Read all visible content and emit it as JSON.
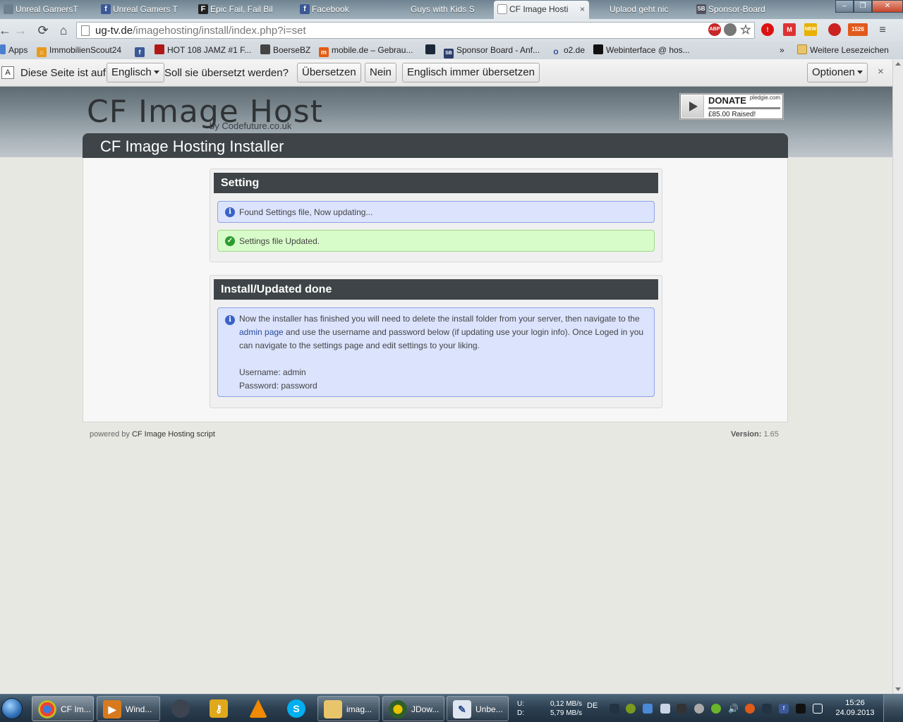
{
  "browser": {
    "tabs": [
      {
        "label": "Unreal GamersT",
        "icon": "generic-favicon",
        "active": false
      },
      {
        "label": "Unreal Gamers T",
        "icon": "facebook-favicon",
        "active": false
      },
      {
        "label": "Epic Fail, Fail Bil",
        "icon": "f-favicon",
        "active": false
      },
      {
        "label": "Facebook",
        "icon": "facebook-favicon",
        "active": false
      },
      {
        "label": "Guys with Kids S",
        "icon": "generic-favicon",
        "active": false
      },
      {
        "label": "CF Image Hosti",
        "icon": "page-favicon",
        "active": true
      },
      {
        "label": "Uplaod geht nic",
        "icon": "generic-favicon",
        "active": false
      },
      {
        "label": "Sponsor-Board",
        "icon": "sb-favicon",
        "active": false
      }
    ],
    "tab_close_glyph": "×",
    "window_controls": [
      "–",
      "❐",
      "✕"
    ],
    "url": {
      "host": "ug-tv.de",
      "path": "/imagehosting/install/index.php?i=set"
    },
    "extension_badges": {
      "abp": "ABP",
      "new": "NEW",
      "count": "1526"
    },
    "bookmarks": [
      {
        "label": "Apps",
        "icon": "apps-icon"
      },
      {
        "label": "ImmobilienScout24",
        "icon": "house-icon"
      },
      {
        "label": "",
        "icon": "facebook-icon"
      },
      {
        "label": "HOT 108 JAMZ #1 F...",
        "icon": "radio-icon"
      },
      {
        "label": "BoerseBZ",
        "icon": "boerse-icon"
      },
      {
        "label": "mobile.de – Gebrau...",
        "icon": "mobile-de-icon"
      },
      {
        "label": "",
        "icon": "steam-icon"
      },
      {
        "label": "Sponsor Board - Anf...",
        "icon": "sb-icon"
      },
      {
        "label": "o2.de",
        "icon": "o2-icon"
      },
      {
        "label": "Webinterface @ hos...",
        "icon": "terminal-icon"
      }
    ],
    "bookmarks_overflow": "»",
    "other_bookmarks": "Weitere Lesezeichen"
  },
  "translate_bar": {
    "prefix": "Diese Seite ist auf",
    "language": "Englisch",
    "question": "Soll sie übersetzt werden?",
    "translate": "Übersetzen",
    "no": "Nein",
    "always": "Englisch immer übersetzen",
    "options": "Optionen",
    "close": "×"
  },
  "page": {
    "logo": "CF Image Host",
    "logo_sub": "by Codefuture.co.uk",
    "donate": {
      "label": "DONATE",
      "site": "pledgie.com",
      "raised": "£85.00 Raised!"
    },
    "title": "CF Image Hosting Installer",
    "setting_box": {
      "heading": "Setting",
      "info": "Found Settings file, Now updating...",
      "success": "Settings file Updated."
    },
    "done_box": {
      "heading": "Install/Updated done",
      "text_before_link": "Now the installer has finished you will need to delete the install folder from your server, then navigate to the ",
      "link": "admin page",
      "text_after_link": " and use the username and password below (if updating use your login info). Once Loged in you can navigate to the settings page and edit settings to your liking.",
      "username": "Username: admin",
      "password": "Password: password"
    },
    "footer": {
      "powered_by": "powered by",
      "script": "CF Image Hosting script",
      "version_label": "Version:",
      "version": "1.65"
    }
  },
  "taskbar": {
    "items": [
      {
        "label": "CF Im...",
        "icon": "chrome-icon"
      },
      {
        "label": "Wind...",
        "icon": "media-player-icon"
      },
      {
        "label": "",
        "icon": "steam-icon"
      },
      {
        "label": "",
        "icon": "keys-icon"
      },
      {
        "label": "",
        "icon": "vlc-icon"
      },
      {
        "label": "",
        "icon": "skype-icon"
      },
      {
        "label": "imag...",
        "icon": "folder-icon"
      },
      {
        "label": "JDow...",
        "icon": "jdownloader-icon"
      },
      {
        "label": "Unbe...",
        "icon": "paint-icon"
      }
    ],
    "net": {
      "up_label": "U:",
      "down_label": "D:",
      "up": "0,12 MB/s",
      "down": "5,79 MB/s"
    },
    "lang": "DE",
    "clock": {
      "time": "15:26",
      "date": "24.09.2013"
    }
  }
}
